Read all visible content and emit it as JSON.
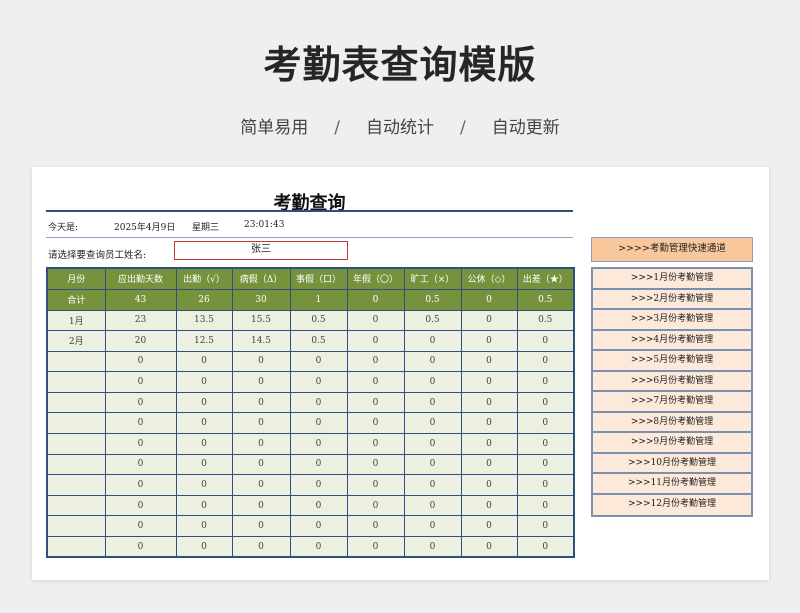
{
  "header": {
    "title": "考勤表查询模版",
    "tags": [
      "简单易用",
      "自动统计",
      "自动更新"
    ],
    "separator": "/"
  },
  "sheet": {
    "title": "考勤查询",
    "today_label": "今天是:",
    "date": "2025年4月9日",
    "weekday": "星期三",
    "time": "23:01:43",
    "employee_label": "请选择要查询员工姓名:",
    "employee_value": "张三"
  },
  "table": {
    "headers": [
      "月份",
      "应出勤天数",
      "出勤（√）",
      "病假（Δ）",
      "事假（口）",
      "年假（〇）",
      "旷工（×）",
      "公休（◇）",
      "出差（★）"
    ],
    "total": [
      "合计",
      "43",
      "26",
      "30",
      "1",
      "0",
      "0.5",
      "0",
      "0.5"
    ],
    "rows": [
      [
        "1月",
        "23",
        "13.5",
        "15.5",
        "0.5",
        "0",
        "0.5",
        "0",
        "0.5"
      ],
      [
        "2月",
        "20",
        "12.5",
        "14.5",
        "0.5",
        "0",
        "0",
        "0",
        "0"
      ],
      [
        "",
        "0",
        "0",
        "0",
        "0",
        "0",
        "0",
        "0",
        "0"
      ],
      [
        "",
        "0",
        "0",
        "0",
        "0",
        "0",
        "0",
        "0",
        "0"
      ],
      [
        "",
        "0",
        "0",
        "0",
        "0",
        "0",
        "0",
        "0",
        "0"
      ],
      [
        "",
        "0",
        "0",
        "0",
        "0",
        "0",
        "0",
        "0",
        "0"
      ],
      [
        "",
        "0",
        "0",
        "0",
        "0",
        "0",
        "0",
        "0",
        "0"
      ],
      [
        "",
        "0",
        "0",
        "0",
        "0",
        "0",
        "0",
        "0",
        "0"
      ],
      [
        "",
        "0",
        "0",
        "0",
        "0",
        "0",
        "0",
        "0",
        "0"
      ],
      [
        "",
        "0",
        "0",
        "0",
        "0",
        "0",
        "0",
        "0",
        "0"
      ],
      [
        "",
        "0",
        "0",
        "0",
        "0",
        "0",
        "0",
        "0",
        "0"
      ],
      [
        "",
        "0",
        "0",
        "0",
        "0",
        "0",
        "0",
        "0",
        "0"
      ]
    ]
  },
  "nav": {
    "title": ">>>>考勤管理快速通道",
    "items": [
      ">>>1月份考勤管理",
      ">>>2月份考勤管理",
      ">>>3月份考勤管理",
      ">>>4月份考勤管理",
      ">>>5月份考勤管理",
      ">>>6月份考勤管理",
      ">>>7月份考勤管理",
      ">>>8月份考勤管理",
      ">>>9月份考勤管理",
      ">>>10月份考勤管理",
      ">>>11月份考勤管理",
      ">>>12月份考勤管理"
    ]
  },
  "colors": {
    "header_green": "#76923c",
    "cell_green": "#ebf1de",
    "border_blue": "#2f4f80",
    "nav_head": "#f8c79b",
    "nav_item": "#fde9d9",
    "input_border": "#c0393b"
  }
}
